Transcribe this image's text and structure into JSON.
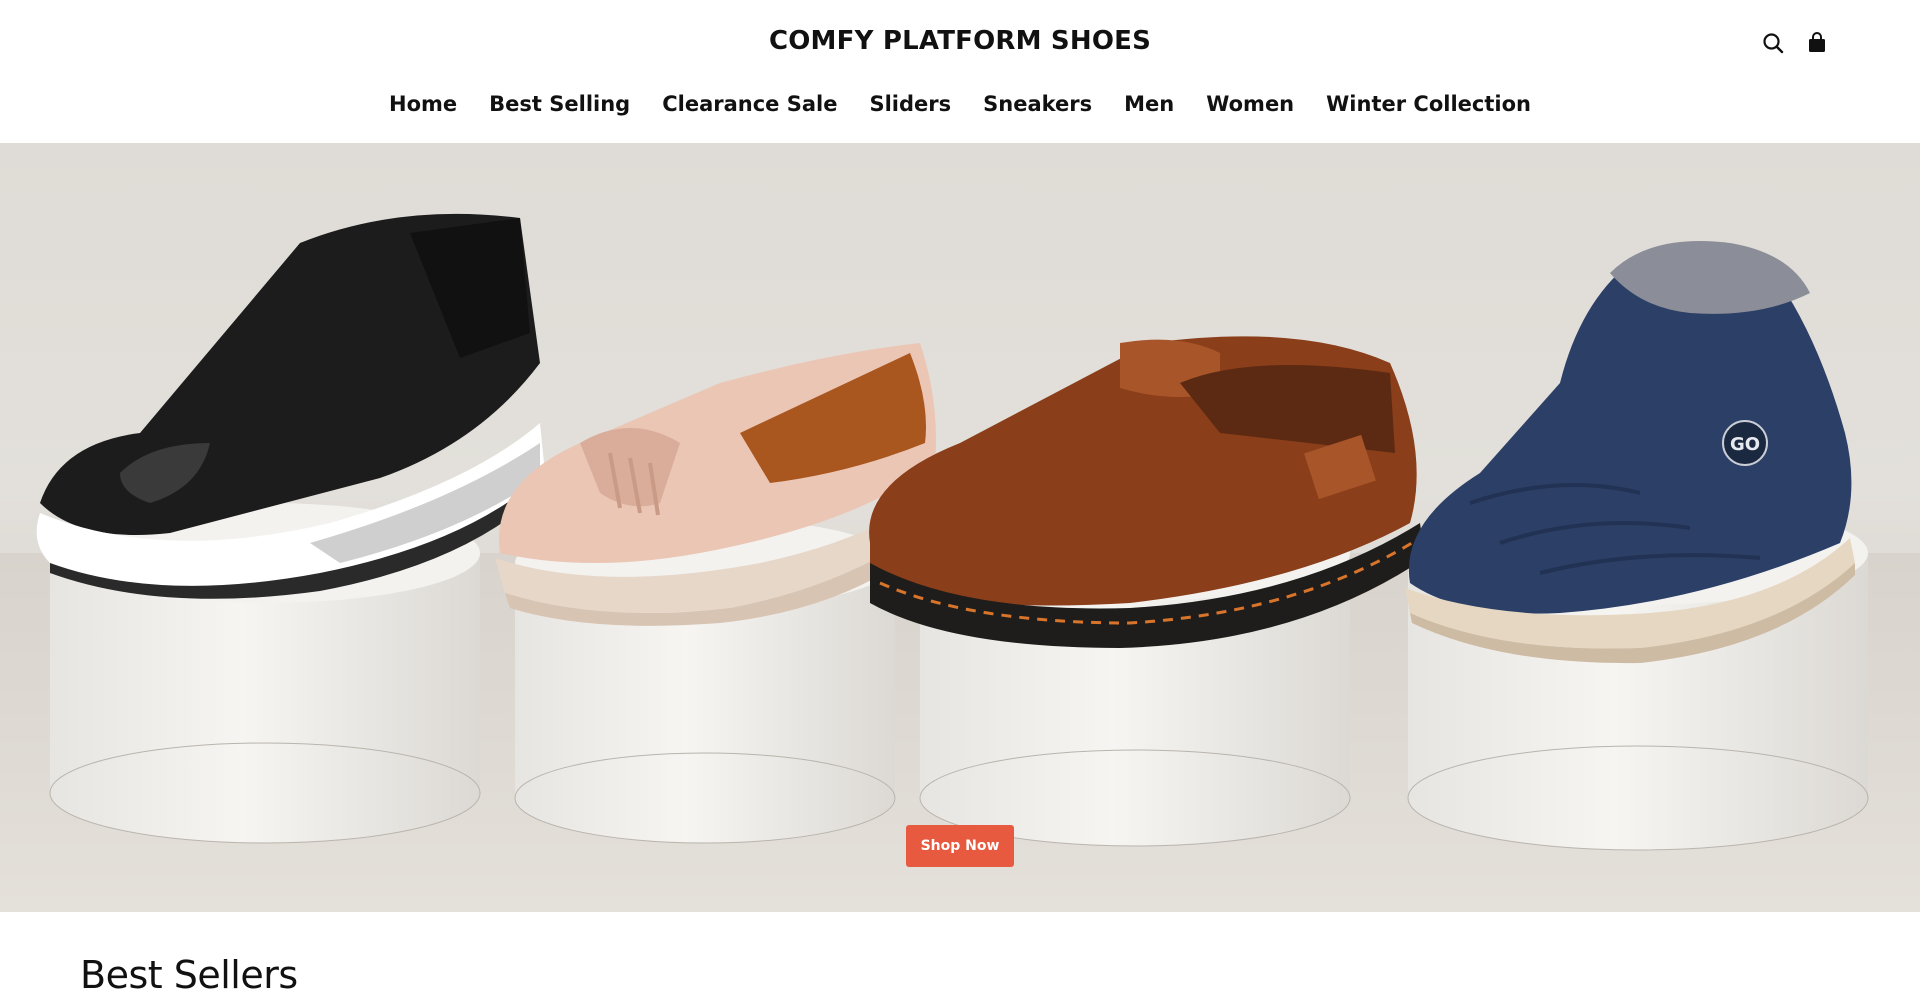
{
  "header": {
    "logo": "COMFY PLATFORM SHOES",
    "icons": [
      "search-icon",
      "bag-icon"
    ]
  },
  "nav": {
    "items": [
      {
        "label": "Home"
      },
      {
        "label": "Best Selling"
      },
      {
        "label": "Clearance Sale"
      },
      {
        "label": "Sliders"
      },
      {
        "label": "Sneakers"
      },
      {
        "label": "Men"
      },
      {
        "label": "Women"
      },
      {
        "label": "Winter Collection"
      }
    ]
  },
  "hero": {
    "cta_label": "Shop Now",
    "badge_text": "GO",
    "colors": {
      "background": "#dfdbd6",
      "pedestal": "#f1efeb",
      "sandal": "#1c1c1c",
      "loafer": "#e8c4b4",
      "moccasin": "#8a3e1a",
      "boot": "#2c3f66",
      "cta": "#e85a3f"
    }
  },
  "section": {
    "title": "Best Sellers"
  }
}
